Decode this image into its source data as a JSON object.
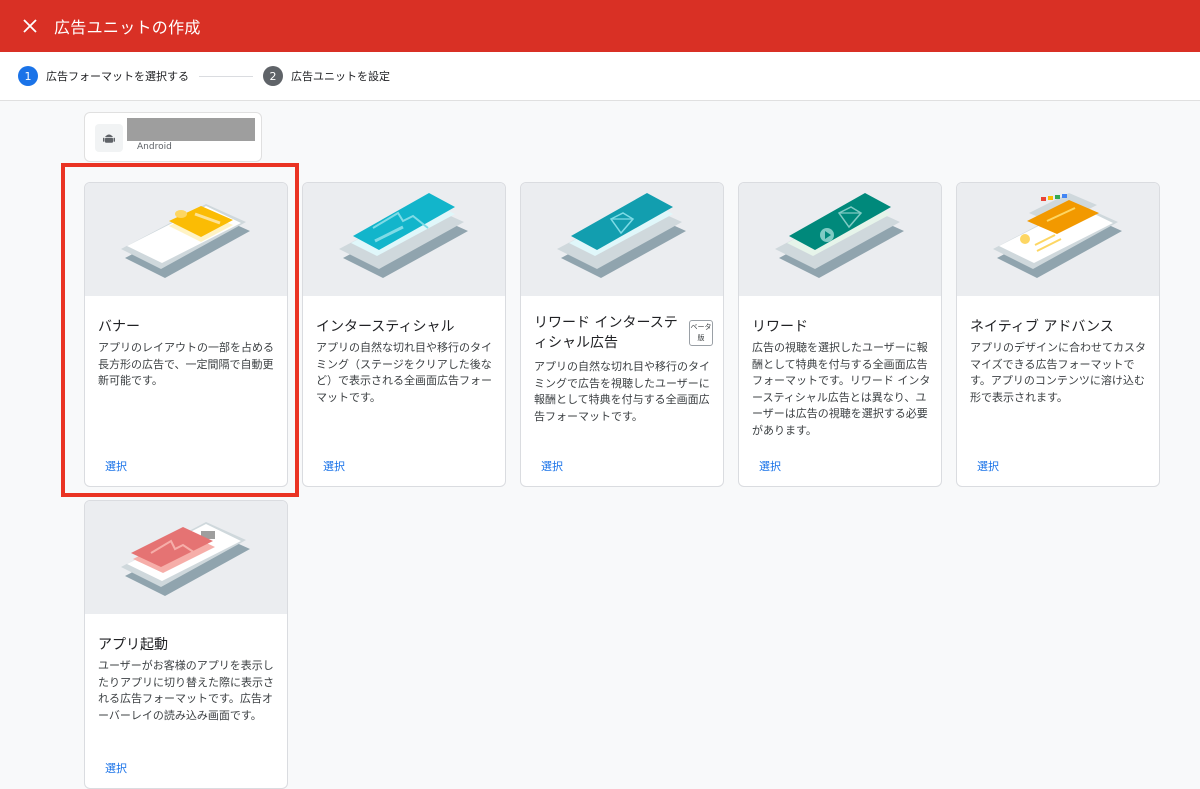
{
  "header": {
    "title": "広告ユニットの作成",
    "close_icon": "close-icon"
  },
  "stepper": {
    "steps": [
      {
        "number": "1",
        "label": "広告フォーマットを選択する",
        "state": "active"
      },
      {
        "number": "2",
        "label": "広告ユニットを設定",
        "state": "inactive"
      }
    ]
  },
  "app": {
    "platform": "Android",
    "icon": "android-icon"
  },
  "formats": [
    {
      "title": "バナー",
      "description": "アプリのレイアウトの一部を占める長方形の広告で、一定間隔で自動更新可能です。",
      "select_label": "選択"
    },
    {
      "title": "インタースティシャル",
      "description": "アプリの自然な切れ目や移行のタイミング（ステージをクリアした後など）で表示される全画面広告フォーマットです。",
      "select_label": "選択"
    },
    {
      "title": "リワード インタースティシャル広告",
      "badge": "ベータ版",
      "description": "アプリの自然な切れ目や移行のタイミングで広告を視聴したユーザーに報酬として特典を付与する全画面広告フォーマットです。",
      "select_label": "選択"
    },
    {
      "title": "リワード",
      "description": "広告の視聴を選択したユーザーに報酬として特典を付与する全画面広告フォーマットです。リワード インタースティシャル広告とは異なり、ユーザーは広告の視聴を選択する必要があります。",
      "select_label": "選択"
    },
    {
      "title": "ネイティブ アドバンス",
      "description": "アプリのデザインに合わせてカスタマイズできる広告フォーマットです。アプリのコンテンツに溶け込む形で表示されます。",
      "select_label": "選択"
    },
    {
      "title": "アプリ起動",
      "description": "ユーザーがお客様のアプリを表示したりアプリに切り替えた際に表示される広告フォーマットです。広告オーバーレイの読み込み画面です。",
      "select_label": "選択"
    }
  ],
  "colors": {
    "header_bg": "#d93025",
    "accent": "#1a73e8",
    "highlight": "#ea3323"
  }
}
